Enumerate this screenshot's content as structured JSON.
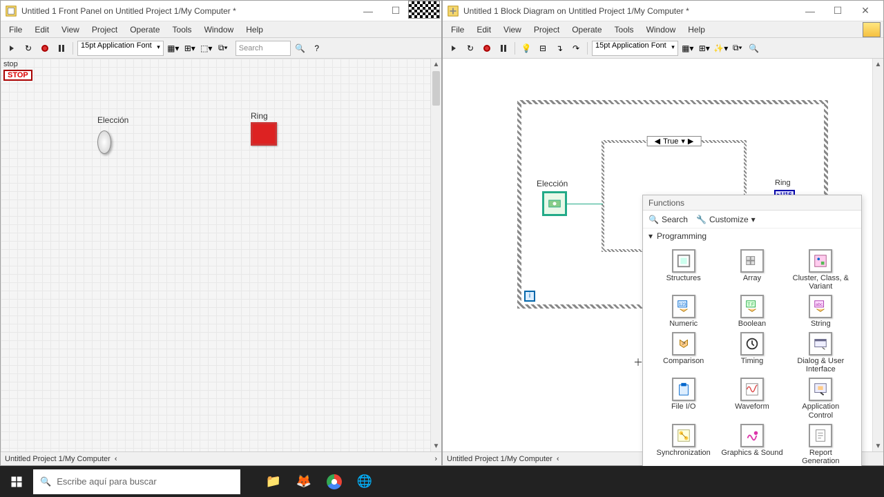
{
  "left_window": {
    "title": "Untitled 1 Front Panel on Untitled Project 1/My Computer *",
    "menu": [
      "File",
      "Edit",
      "View",
      "Project",
      "Operate",
      "Tools",
      "Window",
      "Help"
    ],
    "font": "15pt Application Font",
    "search_ph": "Search",
    "stop_label": "stop",
    "stop_btn": "STOP",
    "eleccion_label": "Elección",
    "ring_label": "Ring",
    "status": "Untitled Project 1/My Computer"
  },
  "right_window": {
    "title": "Untitled 1 Block Diagram on Untitled Project 1/My Computer *",
    "menu": [
      "File",
      "Edit",
      "View",
      "Project",
      "Operate",
      "Tools",
      "Window",
      "Help"
    ],
    "font": "15pt Application Font",
    "case_value": "True",
    "eleccion_label": "Elección",
    "ring_label": "Ring",
    "ring_type": "U16",
    "loop_i": "i",
    "status": "Untitled Project 1/My Computer"
  },
  "palette": {
    "title": "Functions",
    "search": "Search",
    "customize": "Customize",
    "category": "Programming",
    "items": [
      "Structures",
      "Array",
      "Cluster, Class, & Variant",
      "Numeric",
      "Boolean",
      "String",
      "Comparison",
      "Timing",
      "Dialog & User Interface",
      "File I/O",
      "Waveform",
      "Application Control",
      "Synchronization",
      "Graphics & Sound",
      "Report Generation"
    ]
  },
  "taskbar": {
    "search_ph": "Escribe aquí para buscar"
  }
}
